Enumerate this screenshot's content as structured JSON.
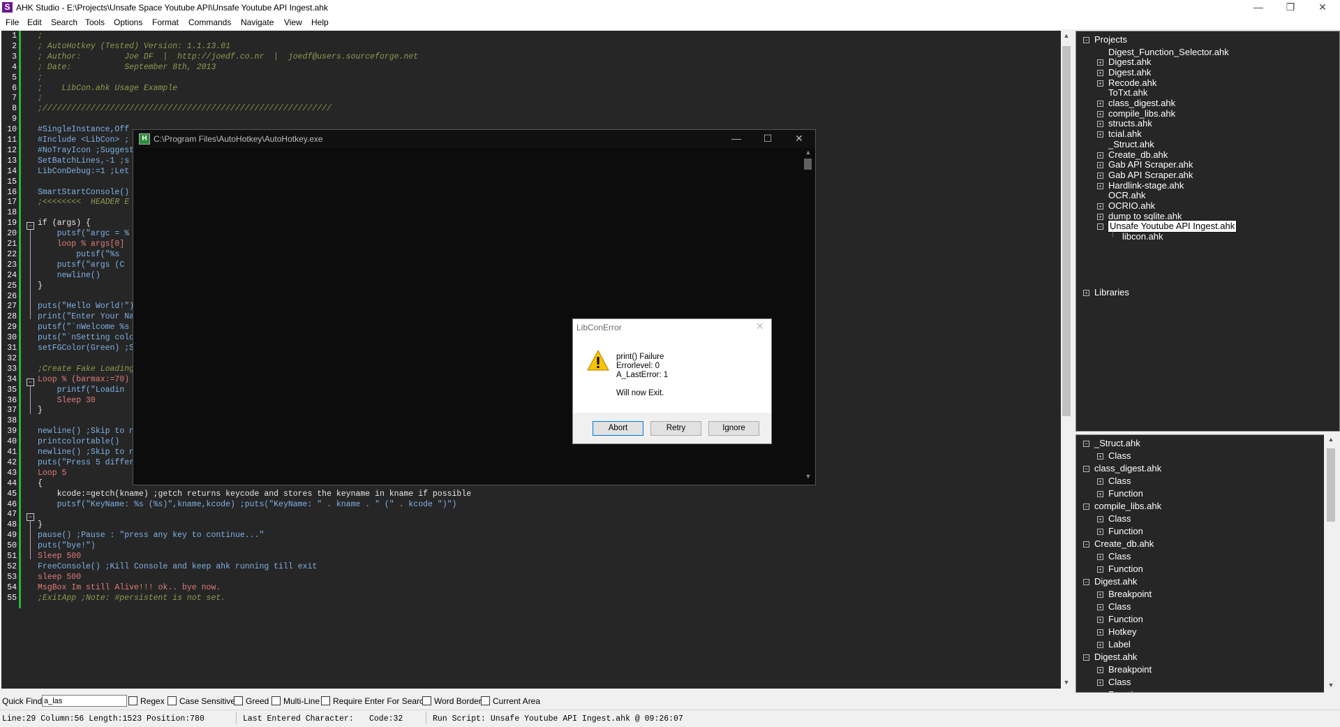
{
  "window": {
    "title": "AHK Studio - E:\\Projects\\Unsafe Space Youtube API\\Unsafe Youtube API Ingest.ahk",
    "app_icon_letter": "S"
  },
  "menu": [
    "File",
    "Edit",
    "Search",
    "Tools",
    "Options",
    "Format",
    "Commands",
    "Navigate",
    "View",
    "Help"
  ],
  "editor": {
    "line_numbers": [
      "1",
      "2",
      "3",
      "4",
      "5",
      "6",
      "7",
      "8",
      "9",
      "10",
      "11",
      "12",
      "13",
      "14",
      "15",
      "16",
      "17",
      "18",
      "19",
      "20",
      "21",
      "22",
      "23",
      "24",
      "25",
      "26",
      "27",
      "28",
      "29",
      "30",
      "31",
      "32",
      "33",
      "34",
      "35",
      "36",
      "37",
      "38",
      "39",
      "40",
      "41",
      "42",
      "43",
      "44",
      "45",
      "46",
      "47",
      "48",
      "49",
      "50",
      "51",
      "52",
      "53",
      "54",
      "55"
    ],
    "lines": [
      ";",
      "; AutoHotkey (Tested) Version: 1.1.13.01",
      "; Author:         Joe DF  |  http://joedf.co.nr  |  joedf@users.sourceforge.net",
      "; Date:           September 8th, 2013",
      ";",
      ";    LibCon.ahk Usage Example",
      ";",
      ";////////////////////////////////////////////////////////////",
      "",
      "#SingleInstance,Off",
      "#Include <LibCon> ;",
      "#NoTrayIcon ;Suggest",
      "SetBatchLines,-1 ;s",
      "LibConDebug:=1 ;Let",
      "",
      "SmartStartConsole()",
      ";<<<<<<<<  HEADER E",
      "",
      "if (args) {",
      "    putsf(\"argc = %",
      "    loop % args[0]",
      "        putsf(\"%s",
      "    putsf(\"args (C",
      "    newline()",
      "}",
      "",
      "puts(\"Hello World!\")",
      "print(\"Enter Your Na",
      "putsf(\"`nWelcome %s",
      "puts(\"`nSetting colo",
      "setFGColor(Green) ;S",
      "",
      ";Create Fake Loading",
      "Loop % (barmax:=70)",
      "    printf(\"Loadin",
      "    Sleep 30",
      "}",
      "",
      "newline() ;Skip to n",
      "printcolortable()",
      "newline() ;Skip to n",
      "puts(\"Press 5 differ",
      "Loop 5",
      "{",
      "    kcode:=getch(kname) ;getch returns keycode and stores the keyname in kname if possible",
      "    putsf(\"KeyName: %s (%s)\",kname,kcode) ;puts(\"KeyName: \" . kname . \" (\" . kcode \")\")",
      "",
      "}",
      "pause() ;Pause : \"press any key to continue...\"",
      "puts(\"bye!\")",
      "Sleep 500",
      "FreeConsole() ;Kill Console and keep ahk running till exit",
      "sleep 500",
      "MsgBox Im still Alive!!! ok.. bye now.",
      ";ExitApp ;Note: #persistent is not set."
    ]
  },
  "project_tree": {
    "root": "Projects",
    "items": [
      {
        "label": "Digest_Function_Selector.ahk",
        "expandable": false
      },
      {
        "label": "Digest.ahk",
        "expandable": true
      },
      {
        "label": "Digest.ahk",
        "expandable": true
      },
      {
        "label": "Recode.ahk",
        "expandable": true
      },
      {
        "label": "ToTxt.ahk",
        "expandable": false
      },
      {
        "label": "class_digest.ahk",
        "expandable": true
      },
      {
        "label": "compile_libs.ahk",
        "expandable": true
      },
      {
        "label": "structs.ahk",
        "expandable": true
      },
      {
        "label": "tcial.ahk",
        "expandable": true
      },
      {
        "label": "_Struct.ahk",
        "expandable": false
      },
      {
        "label": "Create_db.ahk",
        "expandable": true
      },
      {
        "label": "Gab API Scraper.ahk",
        "expandable": true
      },
      {
        "label": "Gab API Scraper.ahk",
        "expandable": true
      },
      {
        "label": "Hardlink-stage.ahk",
        "expandable": true
      },
      {
        "label": "OCR.ahk",
        "expandable": false
      },
      {
        "label": "OCRIO.ahk",
        "expandable": true
      },
      {
        "label": "dump to sqlite.ahk",
        "expandable": true
      },
      {
        "label": "Unsafe Youtube API Ingest.ahk",
        "expandable": true,
        "expanded": true,
        "selected": true
      }
    ],
    "child": "libcon.ahk",
    "root2": "Libraries"
  },
  "code_explorer": {
    "files": [
      {
        "name": "_Struct.ahk",
        "children": [
          "Class"
        ]
      },
      {
        "name": "class_digest.ahk",
        "children": [
          "Class",
          "Function"
        ]
      },
      {
        "name": "compile_libs.ahk",
        "children": [
          "Class",
          "Function"
        ]
      },
      {
        "name": "Create_db.ahk",
        "children": [
          "Class",
          "Function"
        ]
      },
      {
        "name": "Digest.ahk",
        "children": [
          "Breakpoint",
          "Class",
          "Function",
          "Hotkey",
          "Label"
        ]
      },
      {
        "name": "Digest.ahk",
        "children": [
          "Breakpoint",
          "Class",
          "Function"
        ]
      }
    ]
  },
  "quick_find": {
    "label": "Quick Find:",
    "value": "a_las",
    "options": [
      "Regex",
      "Case Sensitive",
      "Greed",
      "Multi-Line",
      "Require Enter For Search",
      "Word Border",
      "Current Area"
    ]
  },
  "status": {
    "position": "Line:29 Column:56 Length:1523 Position:780",
    "last_char": "Last Entered Character:",
    "code": "Code:32",
    "run": "Run Script: Unsafe Youtube API Ingest.ahk @ 09:26:07"
  },
  "console": {
    "title": "C:\\Program Files\\AutoHotkey\\AutoHotkey.exe",
    "icon_letter": "H"
  },
  "msgbox": {
    "title": "LibConError",
    "lines": [
      "print() Failure",
      "Errorlevel: 0",
      "A_LastError: 1"
    ],
    "footer_text": "Will now Exit.",
    "buttons": [
      "Abort",
      "Retry",
      "Ignore"
    ]
  },
  "colors": {
    "editor_bg": "#262626",
    "gutter_bar": "#22b83a",
    "comment": "#8f9a50",
    "function": "#62a6e8",
    "keyword": "#c7484a"
  }
}
